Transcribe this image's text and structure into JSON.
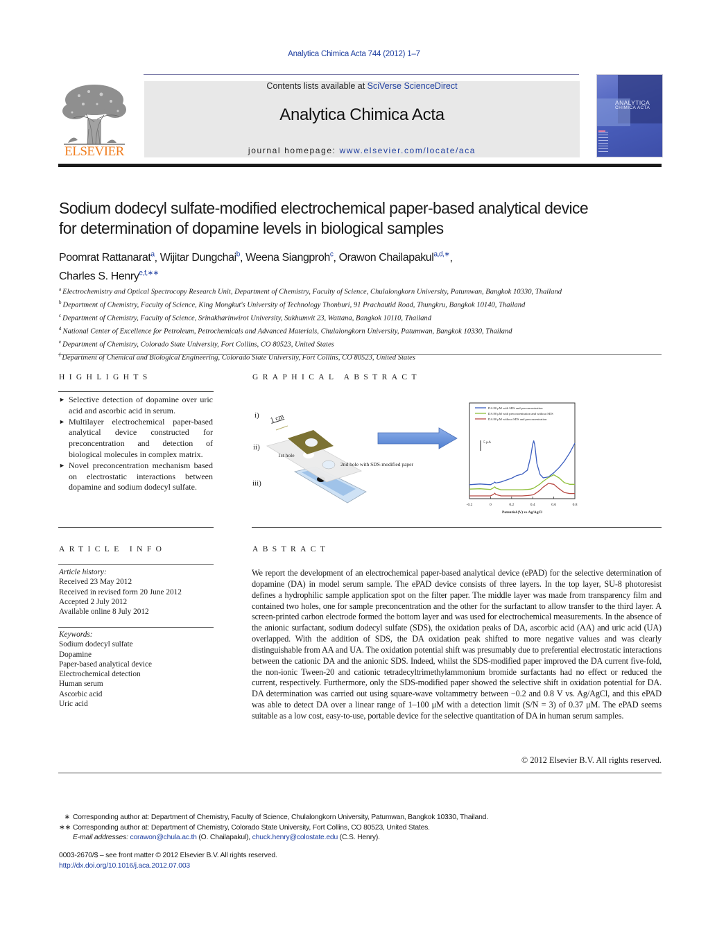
{
  "header": {
    "journal_ref": "Analytica Chimica Acta 744 (2012) 1–7",
    "contents_prefix": "Contents lists available at ",
    "contents_link": "SciVerse ScienceDirect",
    "journal_title": "Analytica Chimica Acta",
    "homepage_prefix": "journal homepage: ",
    "homepage_link": "www.elsevier.com/locate/aca",
    "publisher_logo_text": "ELSEVIER",
    "cover_title_line1": "ANALYTICA",
    "cover_title_line2": "CHIMICA ACTA",
    "colors": {
      "link": "#1f3fa0",
      "elsevier_orange": "#f07d1e",
      "banner": "#e8e8e8"
    }
  },
  "article": {
    "title_line1": "Sodium dodecyl sulfate-modified electrochemical paper-based analytical device",
    "title_line2": "for determination of dopamine levels in biological samples",
    "authors": [
      {
        "name": "Poomrat Rattanarat",
        "sup": "a",
        "sep": ", "
      },
      {
        "name": "Wijitar Dungchai",
        "sup": "b",
        "sep": ", "
      },
      {
        "name": "Weena Siangproh",
        "sup": "c",
        "sep": ", "
      },
      {
        "name": "Orawon Chailapakul",
        "sup": "a,d,∗",
        "sep": ","
      },
      {
        "name": "Charles S. Henry",
        "sup": "e,f,∗∗",
        "sep": ""
      }
    ],
    "affiliations": [
      {
        "key": "a",
        "text": "Electrochemistry and Optical Spectrocopy Research Unit, Department of Chemistry, Faculty of Science, Chulalongkorn University, Patumwan, Bangkok 10330, Thailand"
      },
      {
        "key": "b",
        "text": "Department of Chemistry, Faculty of Science, King Mongkut's University of Technology Thonburi, 91 Prachautid Road, Thungkru, Bangkok 10140, Thailand"
      },
      {
        "key": "c",
        "text": "Department of Chemistry, Faculty of Science, Srinakharinwirot University, Sukhumvit 23, Wattana, Bangkok 10110, Thailand"
      },
      {
        "key": "d",
        "text": "National Center of Excellence for Petroleum, Petrochemicals and Advanced Materials, Chulalongkorn University, Patumwan, Bangkok 10330, Thailand"
      },
      {
        "key": "e",
        "text": "Department of Chemistry, Colorado State University, Fort Collins, CO 80523, United States"
      },
      {
        "key": "f",
        "text": "Department of Chemical and Biological Engineering, Colorado State University, Fort Collins, CO 80523, United States"
      }
    ]
  },
  "highlights": {
    "heading": "HIGHLIGHTS",
    "bullet": "►",
    "items": [
      "Selective detection of dopamine over uric acid and ascorbic acid in serum.",
      "Multilayer electrochemical paper-based analytical device constructed for preconcentration and detection of biological molecules in complex matrix.",
      "Novel preconcentration mechanism based on electrostatic interactions between dopamine and sodium dodecyl sulfate."
    ]
  },
  "graphical_abstract": {
    "heading": "GRAPHICAL ABSTRACT",
    "labels": {
      "layer_i": "i)",
      "layer_ii": "ii)",
      "layer_iii": "iii)",
      "scale": "1 cm",
      "hole1": "1st hole",
      "hole2": "2nd hole with SDS-modified paper"
    }
  },
  "chart_data": {
    "type": "line",
    "title": "",
    "xlabel": "Potential (V) vs Ag/AgCl",
    "ylabel": "",
    "xlim": [
      -0.2,
      0.8
    ],
    "ylim": [
      0,
      20
    ],
    "x_ticks": [
      "-0.2",
      "0",
      "0.2",
      "0.4",
      "0.6",
      "0.8"
    ],
    "scale_bar_label": "5 μA",
    "legend_position": "top",
    "grid": false,
    "x": [
      -0.2,
      -0.1,
      0.0,
      0.03,
      0.04,
      0.05,
      0.1,
      0.2,
      0.25,
      0.3,
      0.35,
      0.38,
      0.4,
      0.41,
      0.42,
      0.44,
      0.47,
      0.5,
      0.55,
      0.6,
      0.65,
      0.7,
      0.75,
      0.8
    ],
    "series": [
      {
        "name": "DA 80 μM with SDS and preconcentration",
        "color": "#3a5dbf",
        "values": [
          3.3,
          3.5,
          3.3,
          3.8,
          4.1,
          3.8,
          4.1,
          5.2,
          6.0,
          6.4,
          7.6,
          11.5,
          15.2,
          16.2,
          15.0,
          9.5,
          6.3,
          5.3,
          5.6,
          6.8,
          8.3,
          10.2,
          12.6,
          15.5
        ]
      },
      {
        "name": "DA 80 μM with preconcentration and without SDS",
        "color": "#8fbf3a",
        "values": [
          2.0,
          2.1,
          1.9,
          2.4,
          2.7,
          2.3,
          1.8,
          1.8,
          1.8,
          1.8,
          1.9,
          2.0,
          2.2,
          2.3,
          2.5,
          2.9,
          3.5,
          4.3,
          5.4,
          6.2,
          5.3,
          3.9,
          3.4,
          3.4
        ]
      },
      {
        "name": "DA 80 μM without SDS and preconcentration",
        "color": "#b84a44",
        "values": [
          0.0,
          0.0,
          0.0,
          0.5,
          0.8,
          0.4,
          0.0,
          0.0,
          0.0,
          0.0,
          0.1,
          0.2,
          0.3,
          0.4,
          0.6,
          1.0,
          1.7,
          2.6,
          3.7,
          3.4,
          2.1,
          1.0,
          0.7,
          0.7
        ]
      }
    ]
  },
  "article_info": {
    "heading": "ARTICLE INFO",
    "history_label": "Article history:",
    "history": [
      "Received 23 May 2012",
      "Received in revised form 20 June 2012",
      "Accepted 2 July 2012",
      "Available online 8 July 2012"
    ],
    "keywords_label": "Keywords:",
    "keywords": [
      "Sodium dodecyl sulfate",
      "Dopamine",
      "Paper-based analytical device",
      "Electrochemical detection",
      "Human serum",
      "Ascorbic acid",
      "Uric acid"
    ]
  },
  "abstract": {
    "heading": "ABSTRACT",
    "text": "We report the development of an electrochemical paper-based analytical device (ePAD) for the selective determination of dopamine (DA) in model serum sample. The ePAD device consists of three layers. In the top layer, SU-8 photoresist defines a hydrophilic sample application spot on the filter paper. The mid­dle layer was made from transparency film and contained two holes, one for sample preconcentration and the other for the surfactant to allow transfer to the third layer. A screen-printed carbon electrode formed the bottom layer and was used for electrochemical measurements. In the absence of the anionic surfactant, sodium dodecyl sulfate (SDS), the oxidation peaks of DA, ascorbic acid (AA) and uric acid (UA) overlapped. With the addition of SDS, the DA oxidation peak shifted to more negative values and was clearly distinguishable from AA and UA. The oxidation potential shift was presumably due to preferential electrostatic interactions between the cationic DA and the anionic SDS. Indeed, whilst the SDS-modified paper improved the DA current five-fold, the non-ionic Tween-20 and cationic tetradecyltrimethylam­monium bromide surfactants had no effect or reduced the current, respectively. Furthermore, only the SDS-modified paper showed the selective shift in oxidation potential for DA. DA determination was car­ried out using square-wave voltammetry between −0.2 and 0.8 V vs. Ag/AgCl, and this ePAD was able to detect DA over a linear range of 1–100 μM with a detection limit (S/N = 3) of 0.37 μM. The ePAD seems suitable as a low cost, easy-to-use, portable device for the selective quantitation of DA in human serum samples.",
    "copyright": "© 2012 Elsevier B.V. All rights reserved."
  },
  "footnotes": {
    "corr1_mark": "∗",
    "corr1_text": "Corresponding author at: Department of Chemistry, Faculty of Science, Chulalongkorn University, Patumwan, Bangkok 10330, Thailand.",
    "corr2_mark": "∗∗",
    "corr2_text": "Corresponding author at: Department of Chemistry, Colorado State University, Fort Collins, CO 80523, United States.",
    "email_label": "E-mail addresses:",
    "email1": "corawon@chula.ac.th",
    "email1_owner": " (O. Chailapakul), ",
    "email2": "chuck.henry@colostate.edu",
    "email2_owner": " (C.S. Henry).",
    "front_matter": "0003-2670/$ – see front matter © 2012 Elsevier B.V. All rights reserved.",
    "doi": "http://dx.doi.org/10.1016/j.aca.2012.07.003"
  }
}
